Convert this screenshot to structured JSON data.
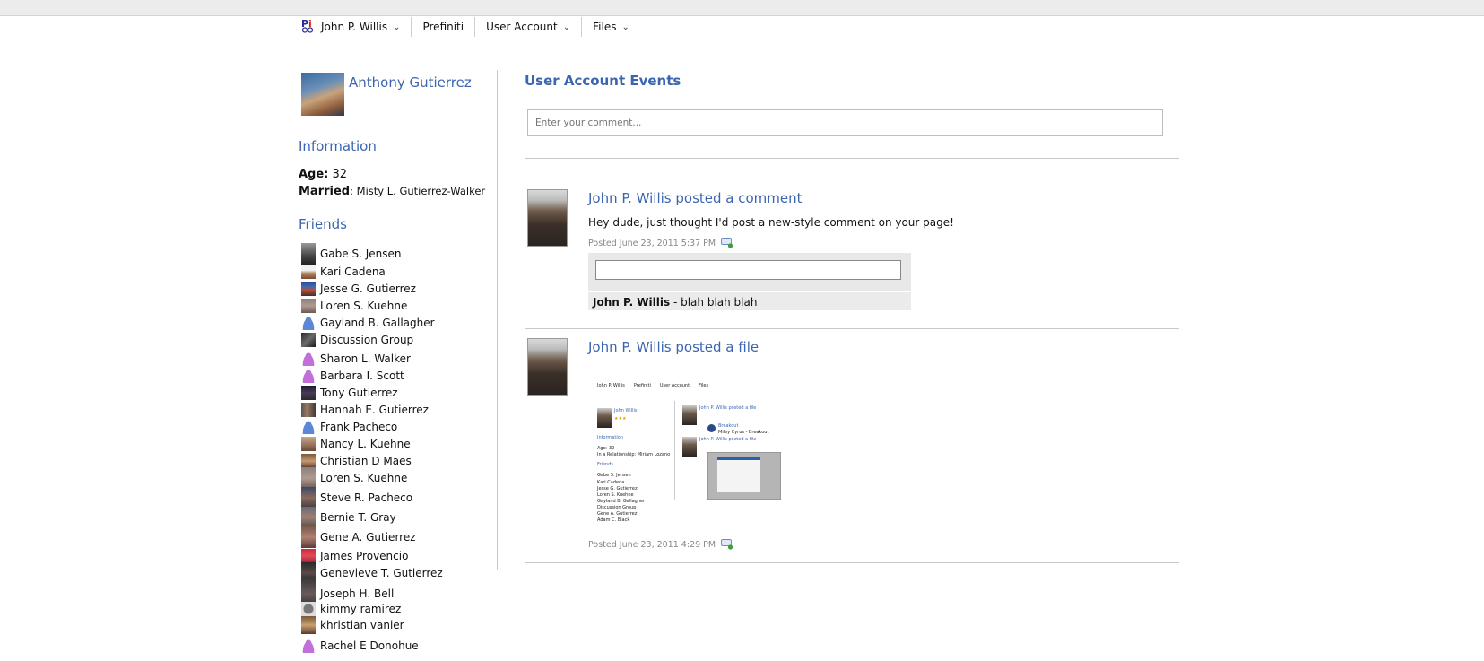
{
  "nav": {
    "user": "John P. Willis",
    "items": [
      "Prefiniti",
      "User Account",
      "Files"
    ]
  },
  "profile": {
    "name": "Anthony Gutierrez",
    "information_heading": "Information",
    "age_label": "Age:",
    "age_value": "32",
    "married_label": "Married",
    "married_value": ": Misty L. Gutierrez-Walker",
    "friends_heading": "Friends",
    "friends": [
      "Gabe S. Jensen",
      "Kari Cadena",
      "Jesse G. Gutierrez",
      "Loren S. Kuehne",
      "Gayland B. Gallagher",
      "Discussion Group",
      "Sharon L. Walker",
      "Barbara I. Scott",
      "Tony Gutierrez",
      "Hannah E. Gutierrez",
      "Frank Pacheco",
      "Nancy L. Kuehne",
      "Christian D Maes",
      "Loren S. Kuehne",
      "Steve R. Pacheco",
      "Bernie T. Gray",
      "Gene A. Gutierrez",
      "James Provencio",
      "Genevieve T. Gutierrez",
      "Joseph H. Bell",
      "kimmy ramirez",
      "khristian vanier",
      "Rachel E Donohue"
    ]
  },
  "main": {
    "title": "User Account Events",
    "comment_placeholder": "Enter your comment...",
    "posts": [
      {
        "title": "John P. Willis posted a comment",
        "body": "Hey dude, just thought I'd post a new-style comment on your page!",
        "meta": "Posted June 23, 2011 5:37 PM",
        "reply_author": "John P. Willis",
        "reply_text": " - blah blah blah"
      },
      {
        "title": "John P. Willis posted a file",
        "meta": "Posted June 23, 2011 4:29 PM",
        "thumbnail": {
          "nav": [
            "John P. Willis",
            "Prefiniti",
            "User Account",
            "Files"
          ],
          "user": "John Willis",
          "stars": "★★★",
          "info": "Information",
          "age": "Age: 30",
          "relationship": "In a Relationship: Miriam Lozano",
          "friends": "Friends",
          "friend_list": [
            "Gabe S. Jensen",
            "Kari Cadena",
            "Jesse G. Gutierrez",
            "Loren S. Kuehne",
            "Gayland B. Gallagher",
            "Discussion Group",
            "Gene A. Gutierrez",
            "Adam C. Black"
          ],
          "post1": "John P. Willis posted a file",
          "breakout": "Breakout",
          "breakout_sub": "Miley Cyrus - Breakout",
          "post2": "John P. Willis posted a file"
        }
      }
    ]
  },
  "colors": {
    "link": "#3b65b0",
    "meta": "#888888",
    "divider": "#c8c8c8"
  }
}
